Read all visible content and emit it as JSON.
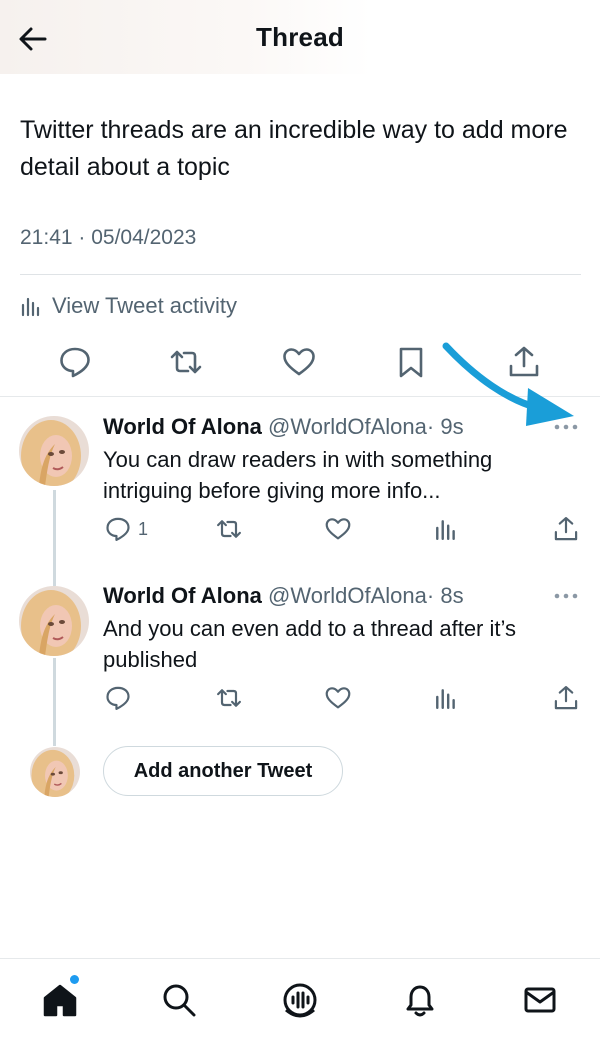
{
  "header": {
    "title": "Thread"
  },
  "main_tweet": {
    "text": "Twitter threads are an incredible way to add more detail about a topic",
    "timestamp": "21:41 · 05/04/2023",
    "activity_label": "View Tweet activity"
  },
  "replies": [
    {
      "name": "World Of Alona",
      "handle": "@WorldOfAlona",
      "time": "· 9s",
      "text": "You can draw readers in with something intriguing before giving more info...",
      "reply_count": "1"
    },
    {
      "name": "World Of Alona",
      "handle": "@WorldOfAlona",
      "time": "· 8s",
      "text": "And you can even add to a thread after it’s published",
      "reply_count": ""
    }
  ],
  "composer": {
    "add_button_label": "Add another Tweet"
  },
  "colors": {
    "accent": "#1d9bf0",
    "arrow": "#1a9ed8",
    "text": "#0f1419",
    "muted": "#536471"
  },
  "nav": [
    "home-icon",
    "search-icon",
    "spaces-icon",
    "notifications-icon",
    "messages-icon"
  ]
}
